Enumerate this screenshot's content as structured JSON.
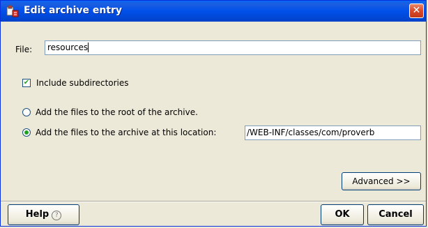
{
  "window": {
    "title": "Edit archive entry",
    "close_glyph": "✕",
    "icon": "archive-app-icon"
  },
  "file": {
    "label": "File:",
    "value": "resources"
  },
  "options": {
    "include_subdirs_label": "Include subdirectories",
    "include_subdirs_checked": true,
    "radio_root_label": "Add the files to the root of the archive.",
    "radio_location_label": "Add the files to the archive at this location:",
    "selected_radio": "location",
    "location_value": "/WEB-INF/classes/com/proverb"
  },
  "buttons": {
    "advanced": "Advanced >>",
    "help": "Help",
    "help_icon": "?",
    "ok": "OK",
    "cancel": "Cancel"
  },
  "colors": {
    "titlebar": "#0050ea",
    "check_accent": "#21a121",
    "close": "#d9492a"
  }
}
